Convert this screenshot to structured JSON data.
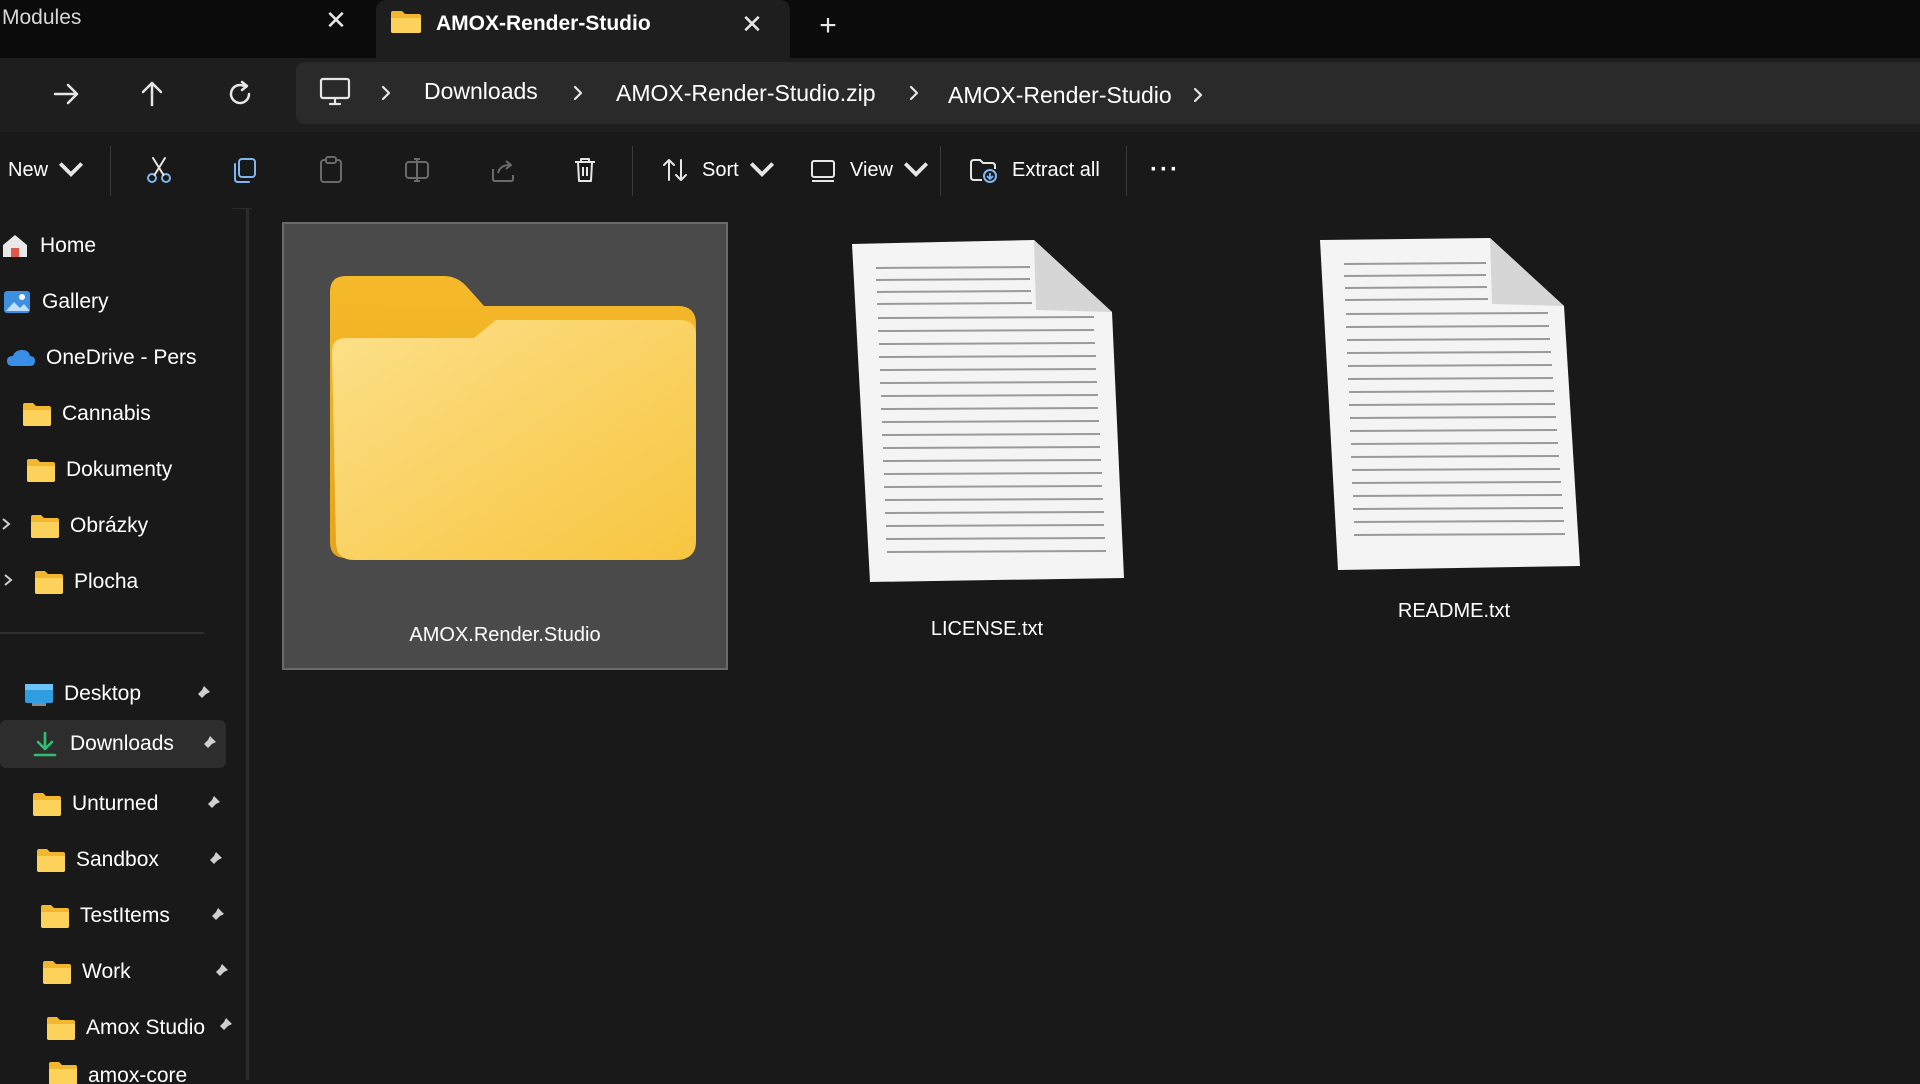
{
  "tabs": [
    {
      "title": "Modules",
      "active": false
    },
    {
      "title": "AMOX-Render-Studio",
      "active": true
    }
  ],
  "new_tab_symbol": "+",
  "close_symbol": "✕",
  "breadcrumb": [
    "Downloads",
    "AMOX-Render-Studio.zip",
    "AMOX-Render-Studio"
  ],
  "toolbar": {
    "new_label": "New",
    "sort_label": "Sort",
    "view_label": "View",
    "extract_label": "Extract all",
    "more_label": "···"
  },
  "sidebar": {
    "top": [
      "Home",
      "Gallery",
      "OneDrive - Pers"
    ],
    "onedrive_folders": [
      "Cannabis",
      "Dokumenty",
      "Obrázky",
      "Plocha"
    ],
    "quick_access": [
      "Desktop",
      "Downloads",
      "Unturned",
      "Sandbox",
      "TestItems",
      "Work",
      "Amox Studio",
      "amox-core"
    ],
    "active_item": "Downloads"
  },
  "items": [
    {
      "name": "AMOX.Render.Studio",
      "type": "folder",
      "selected": true
    },
    {
      "name": "LICENSE.txt",
      "type": "text-file",
      "selected": false
    },
    {
      "name": "README.txt",
      "type": "text-file",
      "selected": false
    }
  ],
  "colors": {
    "background": "#191919",
    "folder_yellow": "#f8c63c",
    "selection": "#4a4a4a",
    "onedrive_blue": "#3a8ee6",
    "downloads_green": "#2fbf71"
  }
}
